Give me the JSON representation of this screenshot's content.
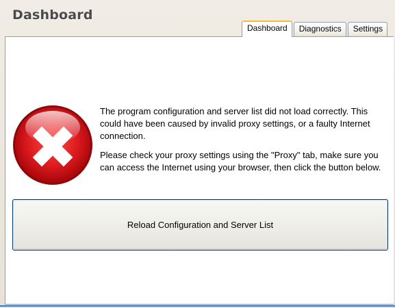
{
  "window": {
    "title": "Dashboard"
  },
  "tabs": [
    {
      "label": "Dashboard",
      "active": true
    },
    {
      "label": "Diagnostics",
      "active": false
    },
    {
      "label": "Settings",
      "active": false
    }
  ],
  "error": {
    "icon": "error-x-icon",
    "paragraph1": "The program configuration and server list did not load correctly. This could have been caused by invalid proxy settings, or a faulty Internet connection.",
    "paragraph2": "Please check your proxy settings using the \"Proxy\" tab, make sure you can access the Internet using your browser, then click the button below."
  },
  "reload_button": {
    "label": "Reload Configuration and Server List"
  },
  "colors": {
    "error_red": "#d9151b",
    "active_tab_accent": "#f5b93c",
    "button_border": "#003c74",
    "status_line": "#2f78d6"
  }
}
